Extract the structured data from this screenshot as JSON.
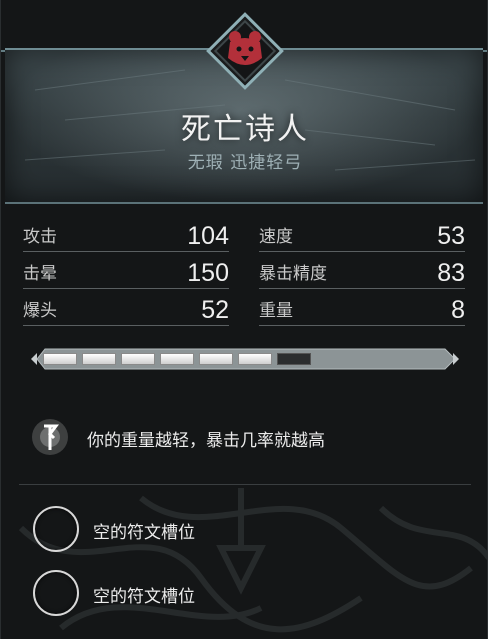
{
  "item": {
    "name": "死亡诗人",
    "subtitle": "无瑕 迅捷轻弓",
    "emblem": "bear-icon",
    "emblem_color": "#b3303a"
  },
  "stats": [
    {
      "label": "攻击",
      "value": "104"
    },
    {
      "label": "速度",
      "value": "53"
    },
    {
      "label": "击晕",
      "value": "150"
    },
    {
      "label": "暴击精度",
      "value": "83"
    },
    {
      "label": "爆头",
      "value": "52"
    },
    {
      "label": "重量",
      "value": "8"
    }
  ],
  "durability": {
    "filled": 6,
    "total": 7
  },
  "perk": {
    "icon": "rune-icon",
    "text": "你的重量越轻，暴击几率就越高"
  },
  "rune_slots": [
    {
      "label": "空的符文槽位"
    },
    {
      "label": "空的符文槽位"
    }
  ]
}
